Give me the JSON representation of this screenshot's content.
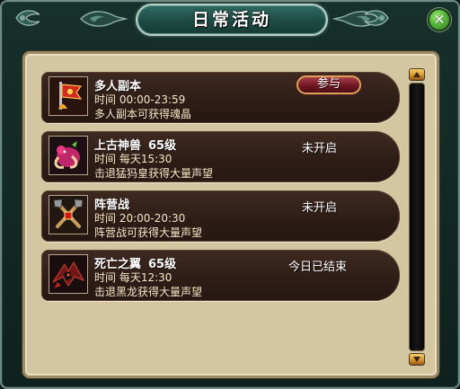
{
  "window": {
    "title": "日常活动",
    "close_icon": "close-icon",
    "colors": {
      "frame": "#163330",
      "panel": "#d5c6a2",
      "row": "#342118",
      "accent": "#d7a160"
    }
  },
  "activities": [
    {
      "name": "多人副本",
      "level": "",
      "time": "时间  00:00-23:59",
      "description": "多人副本可获得魂晶",
      "status": "",
      "action_label": "参与",
      "icon": "banner-flag-icon"
    },
    {
      "name": "上古神兽",
      "level": "65级",
      "time": "时间  每天15:30",
      "description": "击退猛犸皇获得大量声望",
      "status": "未开启",
      "action_label": "",
      "icon": "mammoth-beast-icon"
    },
    {
      "name": "阵营战",
      "level": "",
      "time": "时间  20:00-20:30",
      "description": "阵营战可获得大量声望",
      "status": "未开启",
      "action_label": "",
      "icon": "crossed-axes-icon"
    },
    {
      "name": "死亡之翼",
      "level": "65级",
      "time": "时间  每天12:30",
      "description": "击退黑龙获得大量声望",
      "status": "今日已结束",
      "action_label": "",
      "icon": "black-dragon-icon"
    }
  ],
  "scrollbar": {
    "up_icon": "scroll-up-icon",
    "down_icon": "scroll-down-icon"
  }
}
